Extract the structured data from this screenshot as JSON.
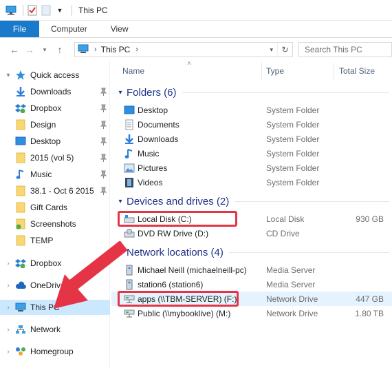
{
  "window": {
    "title": "This PC"
  },
  "ribbon": {
    "tabs": [
      "File",
      "Computer",
      "View"
    ]
  },
  "address": {
    "path_label": "This PC",
    "search_placeholder": "Search This PC"
  },
  "nav": {
    "quick_access": "Quick access",
    "items": [
      {
        "label": "Downloads",
        "icon": "download-arrow-icon",
        "pinned": true
      },
      {
        "label": "Dropbox",
        "icon": "dropbox-icon",
        "pinned": true
      },
      {
        "label": "Design",
        "icon": "folder-icon",
        "pinned": true
      },
      {
        "label": "Desktop",
        "icon": "desktop-icon",
        "pinned": true
      },
      {
        "label": "2015 (vol 5)",
        "icon": "folder-icon",
        "pinned": true
      },
      {
        "label": "Music",
        "icon": "music-note-icon",
        "pinned": true
      },
      {
        "label": "38.1 - Oct 6 2015",
        "icon": "folder-icon",
        "pinned": true
      },
      {
        "label": "Gift Cards",
        "icon": "folder-icon",
        "pinned": false
      },
      {
        "label": "Screenshots",
        "icon": "folder-check-icon",
        "pinned": false
      },
      {
        "label": "TEMP",
        "icon": "folder-icon",
        "pinned": false
      }
    ],
    "roots": [
      "Dropbox",
      "OneDrive",
      "This PC",
      "Network",
      "Homegroup"
    ]
  },
  "columns": {
    "name": "Name",
    "type": "Type",
    "size": "Total Size"
  },
  "groups": {
    "folders": {
      "title": "Folders (6)",
      "items": [
        {
          "name": "Desktop",
          "type": "System Folder"
        },
        {
          "name": "Documents",
          "type": "System Folder"
        },
        {
          "name": "Downloads",
          "type": "System Folder"
        },
        {
          "name": "Music",
          "type": "System Folder"
        },
        {
          "name": "Pictures",
          "type": "System Folder"
        },
        {
          "name": "Videos",
          "type": "System Folder"
        }
      ]
    },
    "drives": {
      "title": "Devices and drives (2)",
      "items": [
        {
          "name": "Local Disk (C:)",
          "type": "Local Disk",
          "size": "930 GB"
        },
        {
          "name": "DVD RW Drive (D:)",
          "type": "CD Drive",
          "size": ""
        }
      ]
    },
    "network": {
      "title": "Network locations (4)",
      "items": [
        {
          "name": "Michael Neill (michaelneill-pc)",
          "type": "Media Server",
          "size": ""
        },
        {
          "name": "station6 (station6)",
          "type": "Media Server",
          "size": ""
        },
        {
          "name": "apps (\\\\TBM-SERVER) (F:)",
          "type": "Network Drive",
          "size": "447 GB"
        },
        {
          "name": "Public (\\\\mybooklive) (M:)",
          "type": "Network Drive",
          "size": "1.80 TB"
        }
      ]
    }
  },
  "colors": {
    "accent": "#1979ca",
    "annotation": "#e53446",
    "group_title": "#1e3287"
  }
}
